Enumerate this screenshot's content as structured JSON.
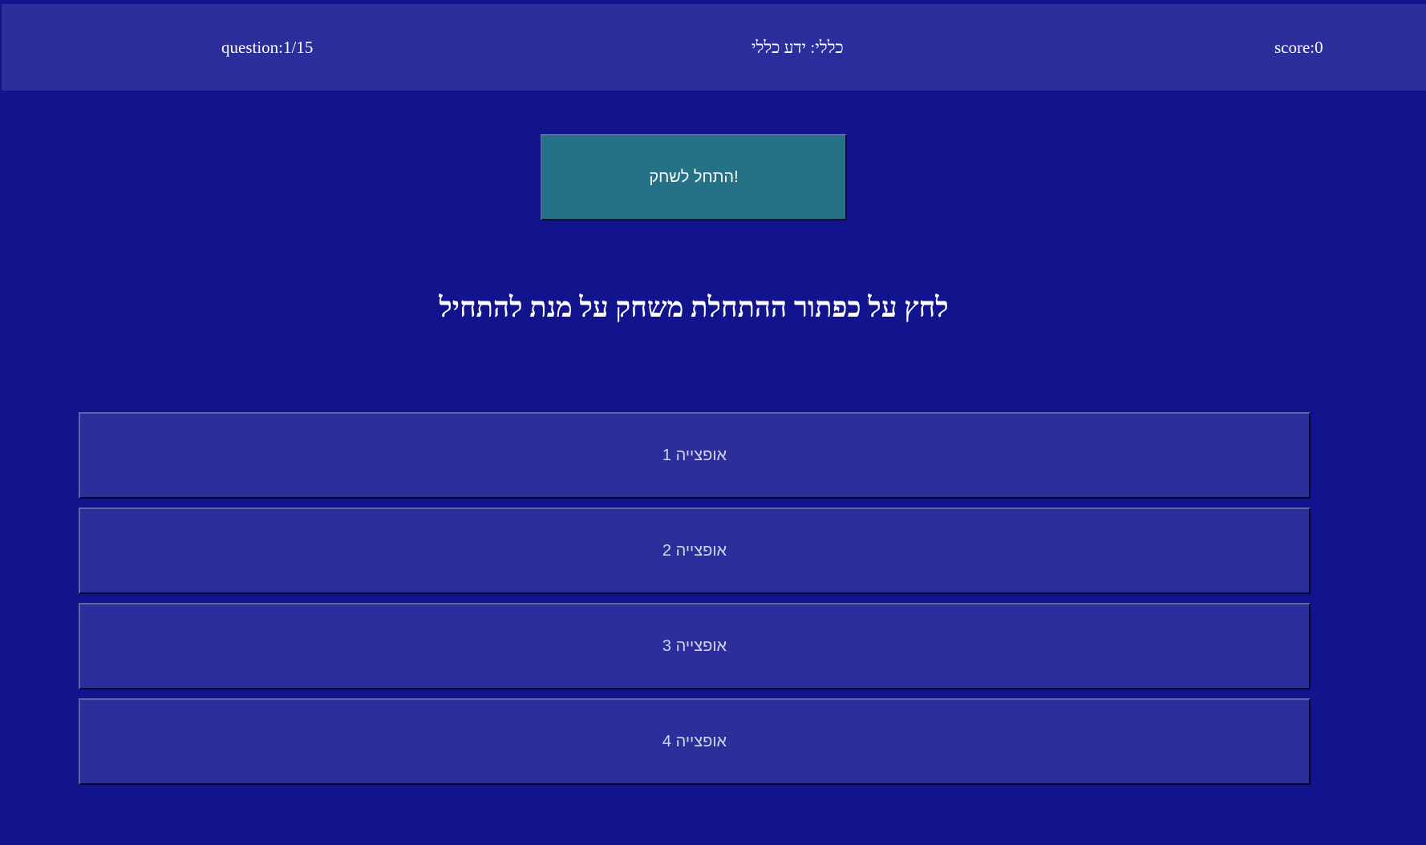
{
  "header": {
    "question_counter": "question:1/15",
    "category": "כללי: ידע כללי",
    "score": "score:0"
  },
  "start_button_label": "התחל לשחק!",
  "question_text": "לחץ על כפתור ההתחלת משחק על מנת להתחיל",
  "options": [
    "אופצייה 1",
    "אופצייה 2",
    "אופצייה 3",
    "אופצייה 4"
  ],
  "colors": {
    "background": "#12148e",
    "panel": "#2b2e9b",
    "start_button": "#257186",
    "text": "#ffffff"
  }
}
